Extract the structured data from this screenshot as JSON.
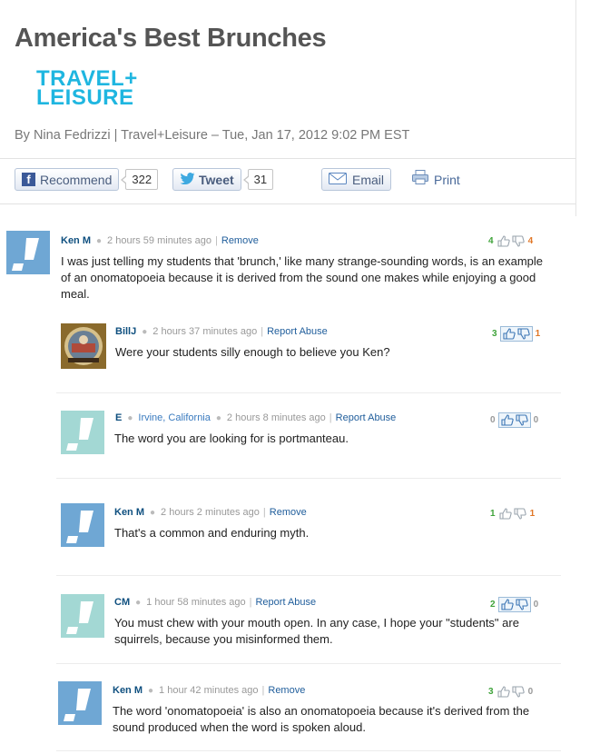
{
  "article": {
    "title": "America's Best Brunches",
    "logo_line1": "TRAVEL+",
    "logo_line2": "LEISURE",
    "byline": "By Nina Fedrizzi | Travel+Leisure – Tue, Jan 17, 2012 9:02 PM EST"
  },
  "share": {
    "recommend_label": "Recommend",
    "recommend_count": "322",
    "tweet_label": "Tweet",
    "tweet_count": "31",
    "email_label": "Email",
    "print_label": "Print"
  },
  "comments": [
    {
      "author": "Ken M",
      "time": "2 hours 59 minutes ago",
      "action": "Remove",
      "text": "I was just telling my students that 'brunch,' like many strange-sounding words, is an example of an onomatopoeia because it is derived from the sound one makes while enjoying a good meal.",
      "up": "4",
      "down": "4"
    },
    {
      "author": "BillJ",
      "time": "2 hours 37 minutes ago",
      "action": "Report Abuse",
      "text": "Were your students silly enough to believe you Ken?",
      "up": "3",
      "down": "1"
    },
    {
      "author": "E",
      "location": "Irvine, California",
      "time": "2 hours 8 minutes ago",
      "action": "Report Abuse",
      "text": "The word you are looking for is portmanteau.",
      "up": "0",
      "down": "0"
    },
    {
      "author": "Ken M",
      "time": "2 hours 2 minutes ago",
      "action": "Remove",
      "text": "That's a common and enduring myth.",
      "up": "1",
      "down": "1"
    },
    {
      "author": "CM",
      "time": "1 hour 58 minutes ago",
      "action": "Report Abuse",
      "text": "You must chew with your mouth open. In any case, I hope your \"students\" are squirrels, because you misinformed them.",
      "up": "2",
      "down": "0"
    },
    {
      "author": "Ken M",
      "time": "1 hour 42 minutes ago",
      "action": "Remove",
      "text": "The word 'onomatopoeia' is also an onomatopoeia because it's derived from the sound produced when the word is spoken aloud.",
      "up": "3",
      "down": "0"
    }
  ],
  "colors": {
    "accent": "#1fb6e0",
    "link": "#1f5d9b",
    "vote_up": "#3fa33a",
    "vote_down": "#e07626",
    "avatar_blue": "#6fa7d4",
    "avatar_teal": "#a3d8d4"
  }
}
